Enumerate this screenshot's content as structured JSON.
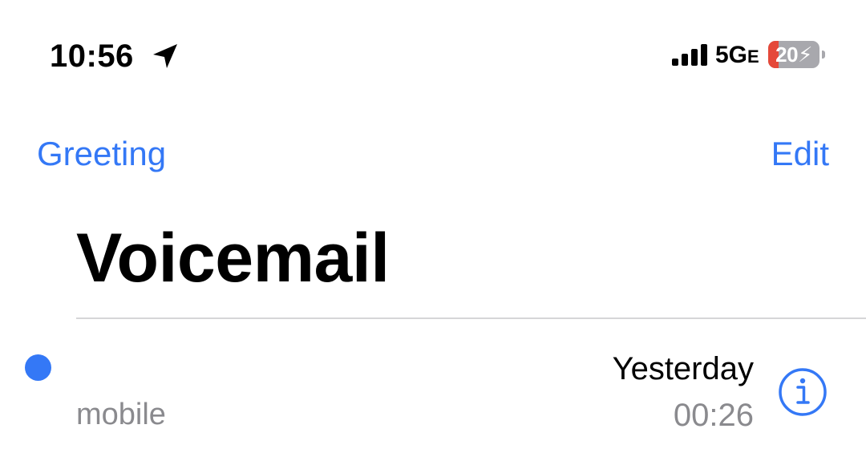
{
  "status_bar": {
    "time": "10:56",
    "location_icon": "location-arrow-icon",
    "signal_icon": "cellular-signal-icon",
    "signal_bars": 4,
    "network": "5G",
    "network_suffix": "E",
    "battery_percent": "20",
    "battery_icon": "battery-charging-icon",
    "battery_level": 0.2,
    "battery_fill_color": "#e5493a",
    "battery_color": "#a8a8ad"
  },
  "nav": {
    "left_label": "Greeting",
    "right_label": "Edit",
    "accent_color": "#3478f6"
  },
  "page": {
    "title": "Voicemail"
  },
  "voicemails": [
    {
      "caller": "",
      "label": "mobile",
      "date": "Yesterday",
      "duration": "00:26",
      "unread": true,
      "info_icon": "info-circle-icon"
    }
  ]
}
